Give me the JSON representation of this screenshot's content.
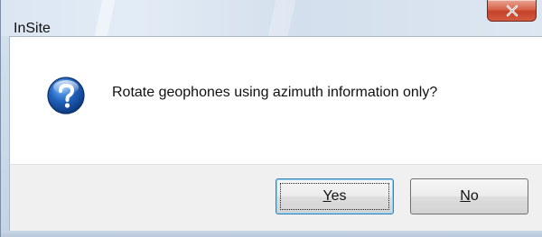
{
  "window": {
    "title": "InSite"
  },
  "icons": {
    "close": "close-icon",
    "question": "question-icon"
  },
  "dialog": {
    "message": "Rotate geophones using azimuth information only?"
  },
  "buttons": {
    "yes": {
      "mnemonic": "Y",
      "rest": "es"
    },
    "no": {
      "mnemonic": "N",
      "rest": "o"
    }
  },
  "colors": {
    "close_button": "#c5412a",
    "default_button_border": "#3c7fb1",
    "question_icon": "#1f5fb8"
  }
}
